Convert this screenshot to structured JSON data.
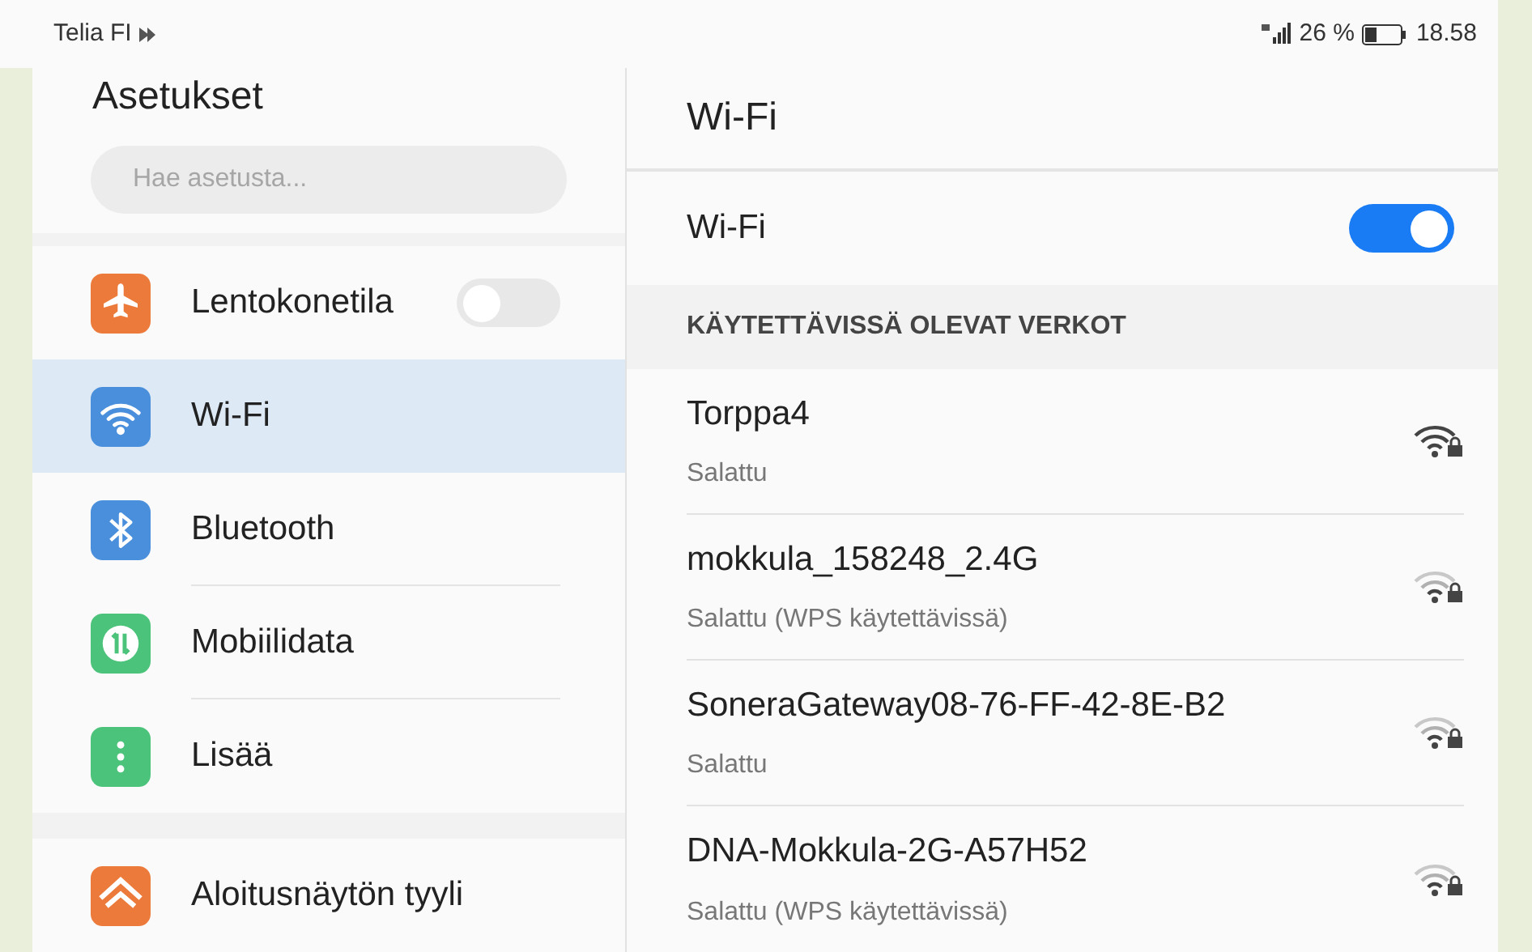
{
  "status_bar": {
    "carrier": "Telia FI",
    "battery_percent": "26 %",
    "time": "18.58"
  },
  "sidebar": {
    "title": "Asetukset",
    "search": {
      "placeholder": "Hae asetusta..."
    },
    "items": [
      {
        "kind": "airplane",
        "label": "Lentokonetila",
        "selected": false,
        "toggle": {
          "on": false
        },
        "color": "#ec7a3a"
      },
      {
        "kind": "wifi",
        "label": "Wi-Fi",
        "selected": true,
        "color": "#4a8fdc"
      },
      {
        "kind": "bluetooth",
        "label": "Bluetooth",
        "selected": false,
        "color": "#4a8fdc"
      },
      {
        "kind": "data",
        "label": "Mobiilidata",
        "selected": false,
        "color": "#4cc37a"
      },
      {
        "kind": "more",
        "label": "Lisää",
        "selected": false,
        "color": "#4cc37a"
      },
      {
        "kind": "home",
        "label": "Aloitusnäytön tyyli",
        "selected": false,
        "color": "#ec7a3a",
        "group_start": true
      }
    ]
  },
  "panel": {
    "title": "Wi-Fi",
    "wifi_toggle": {
      "label": "Wi-Fi",
      "on": true
    },
    "section_header": "KÄYTETTÄVISSÄ OLEVAT VERKOT",
    "networks": [
      {
        "name": "Torppa4",
        "security": "Salattu",
        "strong": true
      },
      {
        "name": "mokkula_158248_2.4G",
        "security": "Salattu (WPS käytettävissä)",
        "strong": false
      },
      {
        "name": "SoneraGateway08-76-FF-42-8E-B2",
        "security": "Salattu",
        "strong": false
      },
      {
        "name": "DNA-Mokkula-2G-A57H52",
        "security": "Salattu (WPS käytettävissä)",
        "strong": false
      }
    ]
  }
}
